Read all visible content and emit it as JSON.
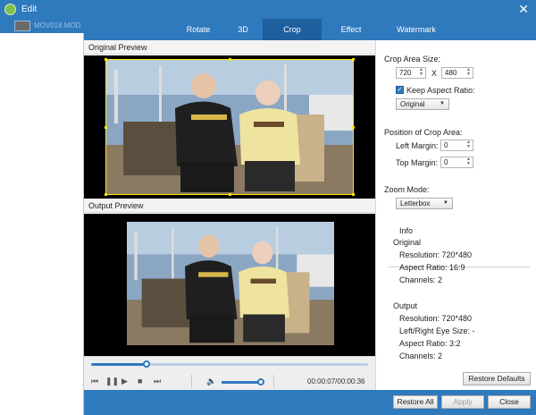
{
  "window": {
    "title": "Edit"
  },
  "file_list": {
    "items": [
      {
        "name": "MOV018.MOD"
      }
    ]
  },
  "tabs": [
    {
      "label": "Rotate"
    },
    {
      "label": "3D"
    },
    {
      "label": "Crop",
      "active": true
    },
    {
      "label": "Effect"
    },
    {
      "label": "Watermark"
    }
  ],
  "previews": {
    "original": "Original Preview",
    "output": "Output Preview"
  },
  "player": {
    "seek_fraction": 0.2,
    "volume_fraction": 0.95,
    "time": "00:00:07/00:00:36"
  },
  "crop": {
    "area_size_label": "Crop Area Size:",
    "width": "720",
    "separator": "X",
    "height": "480",
    "keep_aspect_label": "Keep Aspect Ratio:",
    "keep_aspect_checked": true,
    "aspect_value": "Original",
    "position_label": "Position of Crop Area:",
    "left_margin_label": "Left Margin:",
    "left_margin": "0",
    "top_margin_label": "Top Margin:",
    "top_margin": "0",
    "zoom_label": "Zoom Mode:",
    "zoom_value": "Letterbox"
  },
  "info": {
    "section_label": "Info",
    "original_label": "Original",
    "original_resolution": "Resolution: 720*480",
    "original_aspect": "Aspect Ratio: 16:9",
    "original_channels": "Channels: 2",
    "output_label": "Output",
    "output_resolution": "Resolution: 720*480",
    "output_eye": "Left/Right Eye Size: -",
    "output_aspect": "Aspect Ratio: 3:2",
    "output_channels": "Channels: 2"
  },
  "buttons": {
    "restore_defaults": "Restore Defaults",
    "restore_all": "Restore All",
    "apply": "Apply",
    "close": "Close"
  },
  "colors": {
    "accent": "#2f79bd",
    "crop_frame": "#ffe600"
  }
}
